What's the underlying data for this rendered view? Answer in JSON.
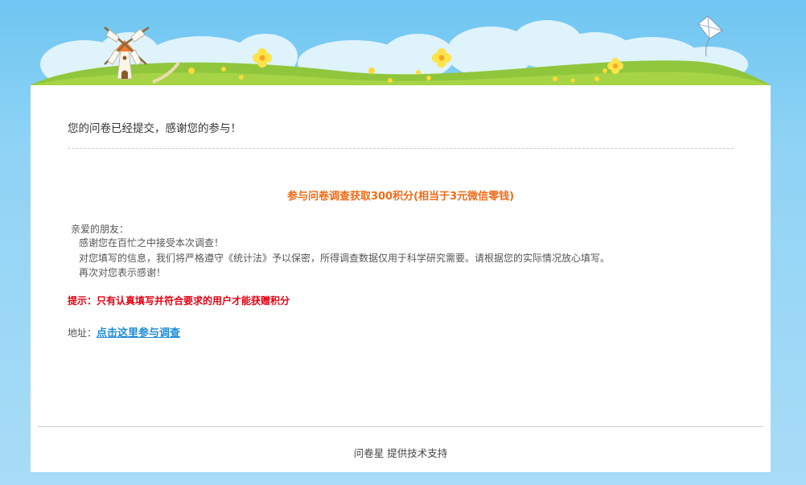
{
  "message": {
    "thanks": "您的问卷已经提交，感谢您的参与！"
  },
  "promo": {
    "title": "参与问卷调查获取300积分(相当于3元微信零钱)",
    "greeting": "亲爱的朋友：",
    "lines": [
      "感谢您在百忙之中接受本次调查！",
      "对您填写的信息，我们将严格遵守《统计法》予以保密，所得调查数据仅用于科学研究需要。请根据您的实际情况放心填写。",
      "再次对您表示感谢！"
    ],
    "tip": "提示：只有认真填写并符合要求的用户才能获赠积分",
    "address_label": "地址：",
    "address_link": "点击这里参与调查"
  },
  "footer": {
    "brand": "问卷星",
    "text": " 提供技术支持"
  },
  "colors": {
    "sky": "#6fc6f2",
    "grass": "#9ccb3c",
    "promo_orange": "#f06b16",
    "tip_red": "#e60012",
    "link_blue": "#1d8ad7"
  },
  "icons": [
    "windmill-icon",
    "kite-icon",
    "flower-icon"
  ]
}
